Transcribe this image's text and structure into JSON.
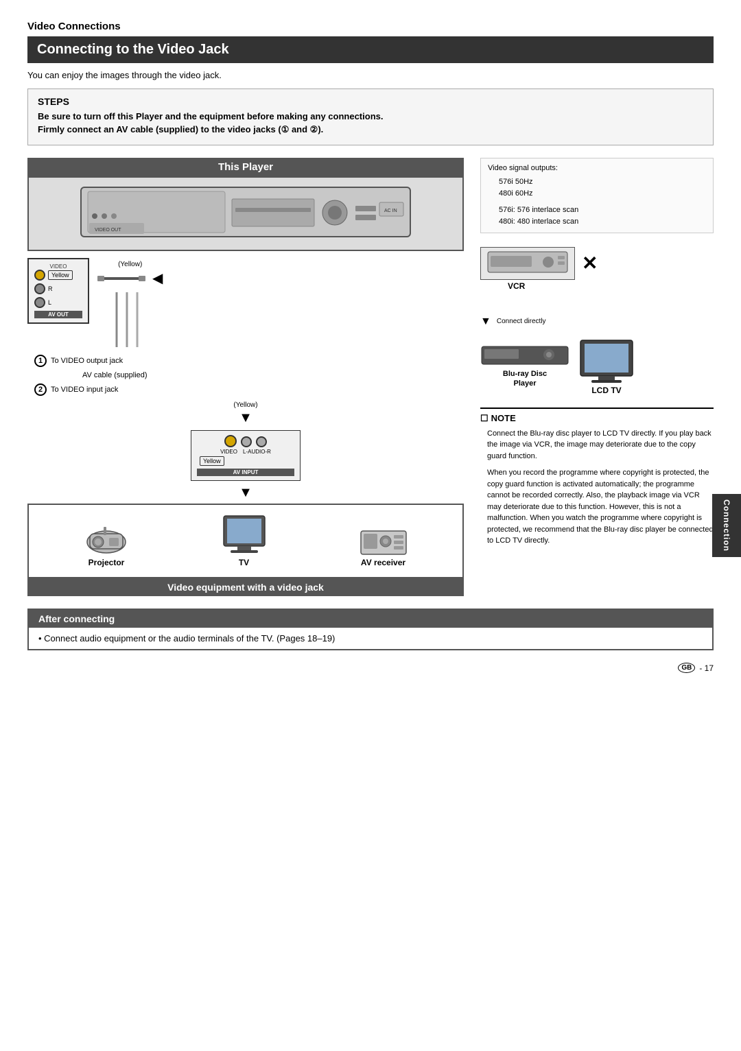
{
  "page": {
    "section_title": "Video Connections",
    "main_heading": "Connecting to the Video Jack",
    "subtitle": "You can enjoy the images through the video jack.",
    "steps_heading": "STEPS",
    "steps": [
      "Be sure to turn off this Player and the equipment before making any connections.",
      "Firmly connect an AV cable (supplied) to the video jacks (① and ②)."
    ],
    "this_player_label": "This Player",
    "video_equipment_label": "Video equipment with a video jack",
    "after_connecting_title": "After connecting",
    "after_connecting_text": "• Connect audio equipment or the audio terminals of the TV. (Pages 18–19)",
    "page_number": "GB - 17",
    "connection_tab": "Connection"
  },
  "signal_info": {
    "title": "Video signal outputs:",
    "lines": [
      "576i  50Hz",
      "480i  60Hz",
      "",
      "576i: 576 interlace scan",
      "480i: 480 interlace scan"
    ]
  },
  "jacks": {
    "yellow_label": "Yellow",
    "video_label": "VIDEO",
    "av_out_label": "AV OUT",
    "av_input_label": "AV INPUT",
    "to_video_output": "To VIDEO output jack",
    "av_cable_label": "AV cable (supplied)",
    "to_video_input": "To VIDEO input jack",
    "l_audio_r": "L-AUDIO-R",
    "jack1": "①",
    "jack2": "②"
  },
  "devices": {
    "vcr_label": "VCR",
    "blu_ray_label": "Blu-ray Disc\nPlayer",
    "lcd_tv_label": "LCD TV",
    "connect_directly": "Connect directly",
    "projector_label": "Projector",
    "tv_label": "TV",
    "av_receiver_label": "AV receiver"
  },
  "note": {
    "title": "NOTE",
    "bullet_icon": "■",
    "items": [
      "Connect the Blu-ray disc player to LCD TV directly. If you play back the image via VCR, the image may deteriorate due to the copy guard function.",
      "When you record the programme where copyright is protected, the copy guard function is activated automatically; the programme cannot be recorded correctly. Also, the playback image via VCR may deteriorate due to this function. However, this is not a malfunction. When you watch the programme where copyright is protected, we recommend that the Blu-ray disc player be connected to LCD TV directly."
    ]
  },
  "icons": {
    "arrow_left": "◀",
    "arrow_down": "▼",
    "arrow_up": "▲",
    "x_mark": "✕",
    "note_icon": "☐",
    "circle1": "①",
    "circle2": "②",
    "gb_badge": "GB"
  }
}
